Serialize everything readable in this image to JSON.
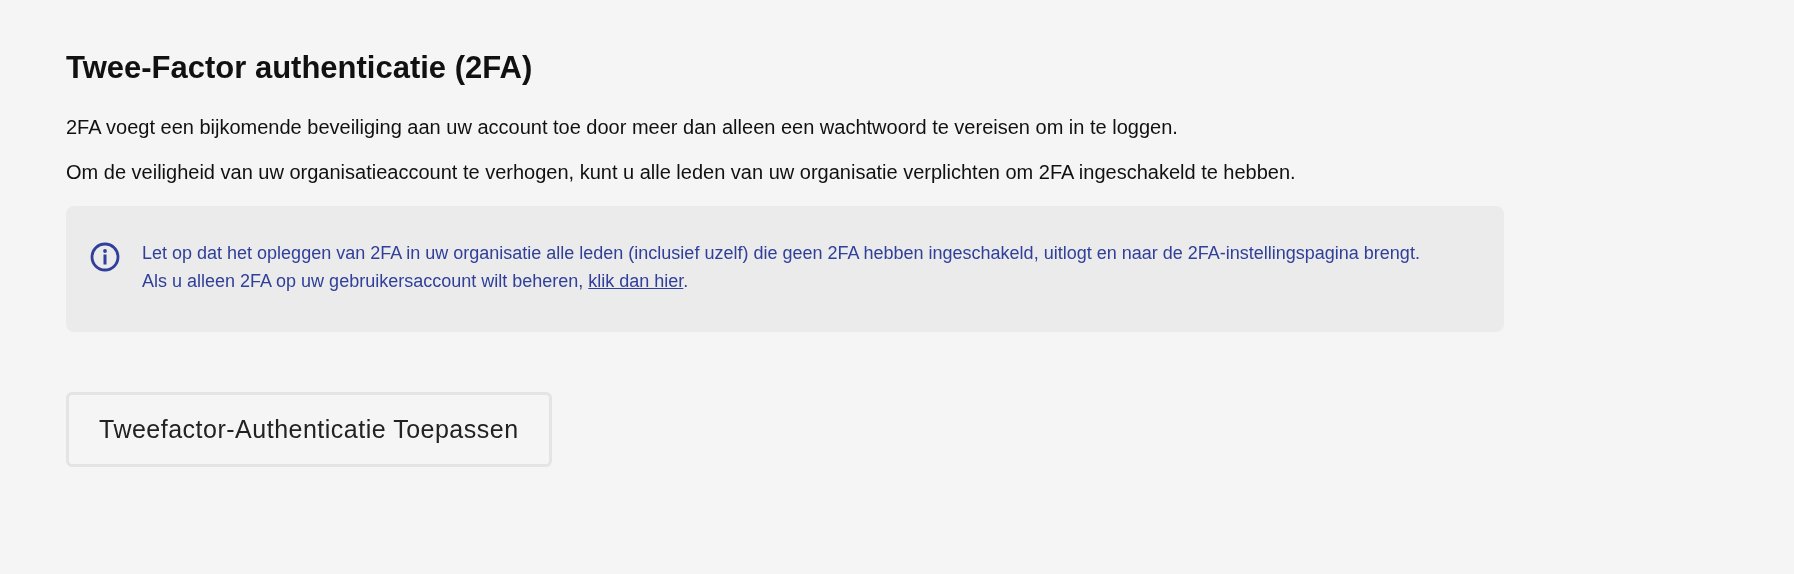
{
  "title": "Twee-Factor authenticatie (2FA)",
  "paragraphs": [
    "2FA voegt een bijkomende beveiliging aan uw account toe door meer dan alleen een wachtwoord te vereisen om in te loggen.",
    "Om de veiligheid van uw organisatieaccount te verhogen, kunt u alle leden van uw organisatie verplichten om 2FA ingeschakeld te hebben."
  ],
  "notice": {
    "text": "Let op dat het opleggen van 2FA in uw organisatie alle leden (inclusief uzelf) die geen 2FA hebben ingeschakeld, uitlogt en naar de 2FA-instellingspagina brengt. Als u alleen 2FA op uw gebruikersaccount wilt beheren, ",
    "link": "klik dan hier",
    "after": "."
  },
  "button": "Tweefactor-Authenticatie Toepassen"
}
